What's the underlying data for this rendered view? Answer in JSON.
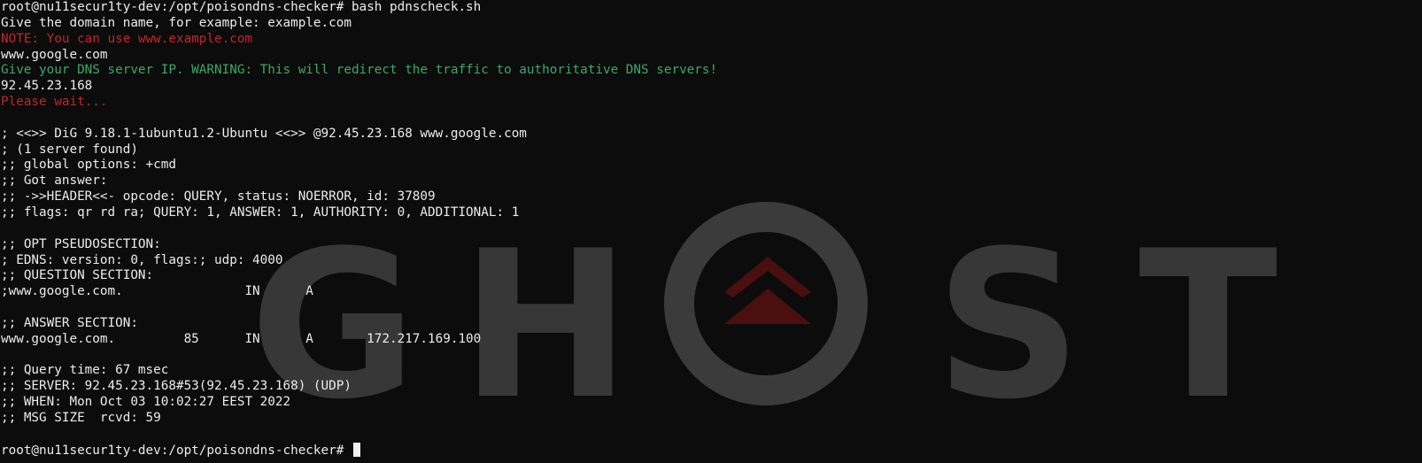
{
  "wallpaper": {
    "letters": [
      "G",
      "H",
      "S",
      "T"
    ]
  },
  "terminal": {
    "lines": [
      {
        "text": "root@nu11secur1ty-dev:/opt/poisondns-checker# bash pdnscheck.sh",
        "color": "white"
      },
      {
        "text": "Give the domain name, for example: example.com",
        "color": "white"
      },
      {
        "text": "NOTE: You can use www.example.com",
        "color": "red"
      },
      {
        "text": "www.google.com",
        "color": "white"
      },
      {
        "text": "Give your DNS server IP. WARNING: This will redirect the traffic to authoritative DNS servers!",
        "color": "green"
      },
      {
        "text": "92.45.23.168",
        "color": "white"
      },
      {
        "text": "Please wait...",
        "color": "red"
      },
      {
        "text": "",
        "color": "white"
      },
      {
        "text": "; <<>> DiG 9.18.1-1ubuntu1.2-Ubuntu <<>> @92.45.23.168 www.google.com",
        "color": "white"
      },
      {
        "text": "; (1 server found)",
        "color": "white"
      },
      {
        "text": ";; global options: +cmd",
        "color": "white"
      },
      {
        "text": ";; Got answer:",
        "color": "white"
      },
      {
        "text": ";; ->>HEADER<<- opcode: QUERY, status: NOERROR, id: 37809",
        "color": "white"
      },
      {
        "text": ";; flags: qr rd ra; QUERY: 1, ANSWER: 1, AUTHORITY: 0, ADDITIONAL: 1",
        "color": "white"
      },
      {
        "text": "",
        "color": "white"
      },
      {
        "text": ";; OPT PSEUDOSECTION:",
        "color": "white"
      },
      {
        "text": "; EDNS: version: 0, flags:; udp: 4000",
        "color": "white"
      },
      {
        "text": ";; QUESTION SECTION:",
        "color": "white"
      },
      {
        "text": ";www.google.com.                IN      A",
        "color": "white"
      },
      {
        "text": "",
        "color": "white"
      },
      {
        "text": ";; ANSWER SECTION:",
        "color": "white"
      },
      {
        "text": "www.google.com.         85      IN      A       172.217.169.100",
        "color": "white"
      },
      {
        "text": "",
        "color": "white"
      },
      {
        "text": ";; Query time: 67 msec",
        "color": "white"
      },
      {
        "text": ";; SERVER: 92.45.23.168#53(92.45.23.168) (UDP)",
        "color": "white"
      },
      {
        "text": ";; WHEN: Mon Oct 03 10:02:27 EEST 2022",
        "color": "white"
      },
      {
        "text": ";; MSG SIZE  rcvd: 59",
        "color": "white"
      },
      {
        "text": "",
        "color": "white"
      },
      {
        "text": "root@nu11secur1ty-dev:/opt/poisondns-checker# ",
        "color": "white",
        "cursor": true
      }
    ]
  },
  "colors": {
    "white": "#ececec",
    "red": "#c0262d",
    "green": "#3aa86a"
  }
}
